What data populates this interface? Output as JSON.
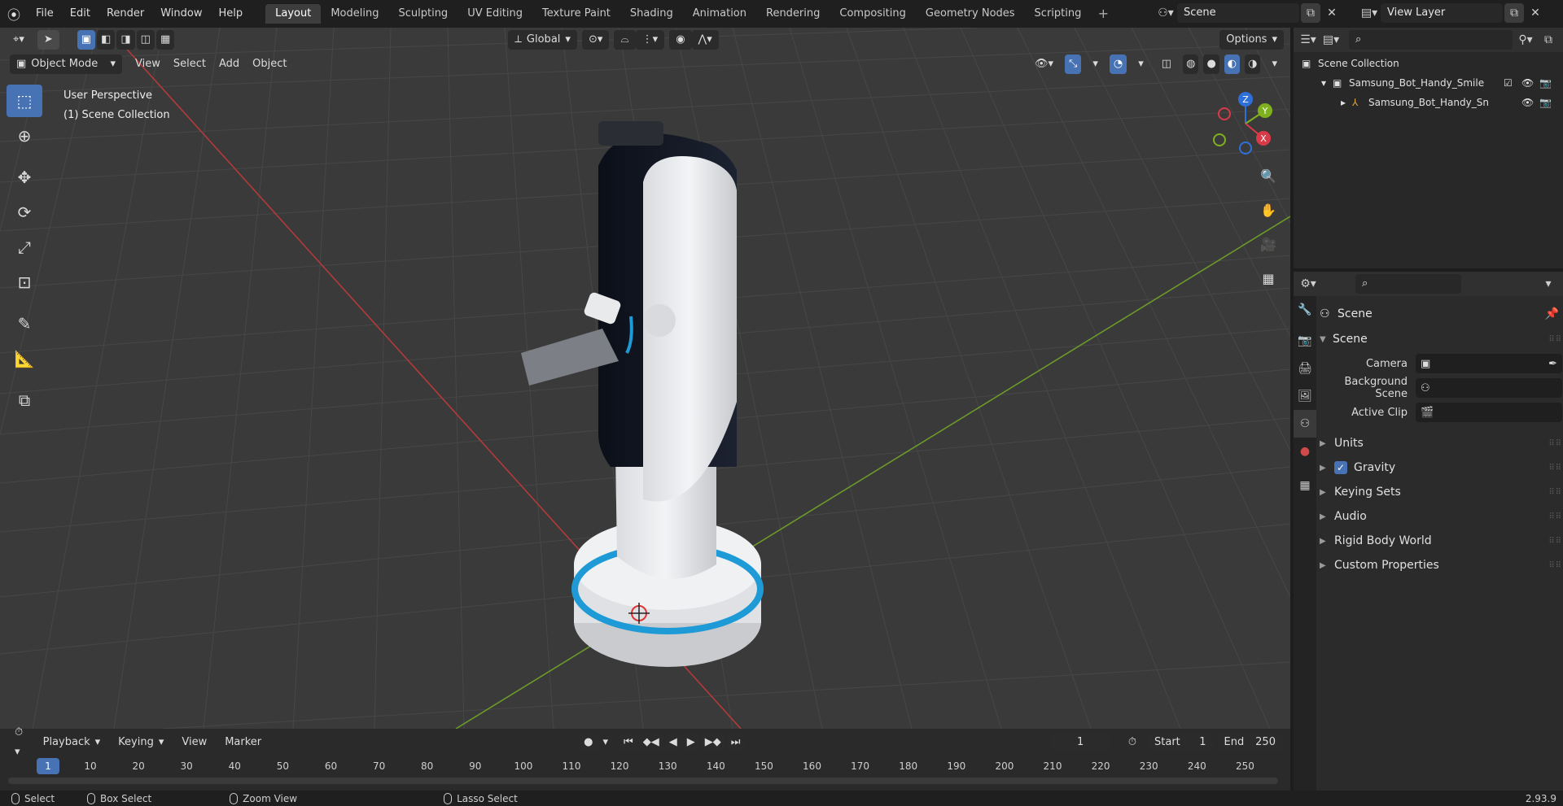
{
  "menu": {
    "file": "File",
    "edit": "Edit",
    "render": "Render",
    "window": "Window",
    "help": "Help"
  },
  "workspaces": [
    {
      "label": "Layout",
      "active": true
    },
    {
      "label": "Modeling"
    },
    {
      "label": "Sculpting"
    },
    {
      "label": "UV Editing"
    },
    {
      "label": "Texture Paint"
    },
    {
      "label": "Shading"
    },
    {
      "label": "Animation"
    },
    {
      "label": "Rendering"
    },
    {
      "label": "Compositing"
    },
    {
      "label": "Geometry Nodes"
    },
    {
      "label": "Scripting"
    }
  ],
  "scene": {
    "name": "Scene",
    "view_layer": "View Layer"
  },
  "viewport": {
    "transform_orientation": "Global",
    "options_label": "Options",
    "mode": "Object Mode",
    "menus": {
      "view": "View",
      "select": "Select",
      "add": "Add",
      "object": "Object"
    },
    "info_line1": "User Perspective",
    "info_line2": "(1) Scene Collection",
    "gizmo_axes": {
      "x": "X",
      "y": "Y",
      "z": "Z"
    }
  },
  "outliner": {
    "root": "Scene Collection",
    "collection": "Samsung_Bot_Handy_Smile",
    "object": "Samsung_Bot_Handy_Sn"
  },
  "properties": {
    "context": "Scene",
    "panel": "Scene",
    "camera_label": "Camera",
    "background_scene_label": "Background Scene",
    "active_clip_label": "Active Clip",
    "subpanels": {
      "units": "Units",
      "gravity": "Gravity",
      "keying_sets": "Keying Sets",
      "audio": "Audio",
      "rigid_body_world": "Rigid Body World",
      "custom_properties": "Custom Properties"
    }
  },
  "timeline": {
    "playback": "Playback",
    "keying": "Keying",
    "view": "View",
    "marker": "Marker",
    "current_frame": "1",
    "start_label": "Start",
    "start_value": "1",
    "end_label": "End",
    "end_value": "250",
    "ruler": [
      "10",
      "20",
      "30",
      "40",
      "50",
      "60",
      "70",
      "80",
      "90",
      "100",
      "110",
      "120",
      "130",
      "140",
      "150",
      "160",
      "170",
      "180",
      "190",
      "200",
      "210",
      "220",
      "230",
      "240",
      "250"
    ],
    "cursor_frame": "1"
  },
  "statusbar": {
    "select": "Select",
    "box_select": "Box Select",
    "zoom_view": "Zoom View",
    "lasso_select": "Lasso Select",
    "version": "2.93.9"
  }
}
